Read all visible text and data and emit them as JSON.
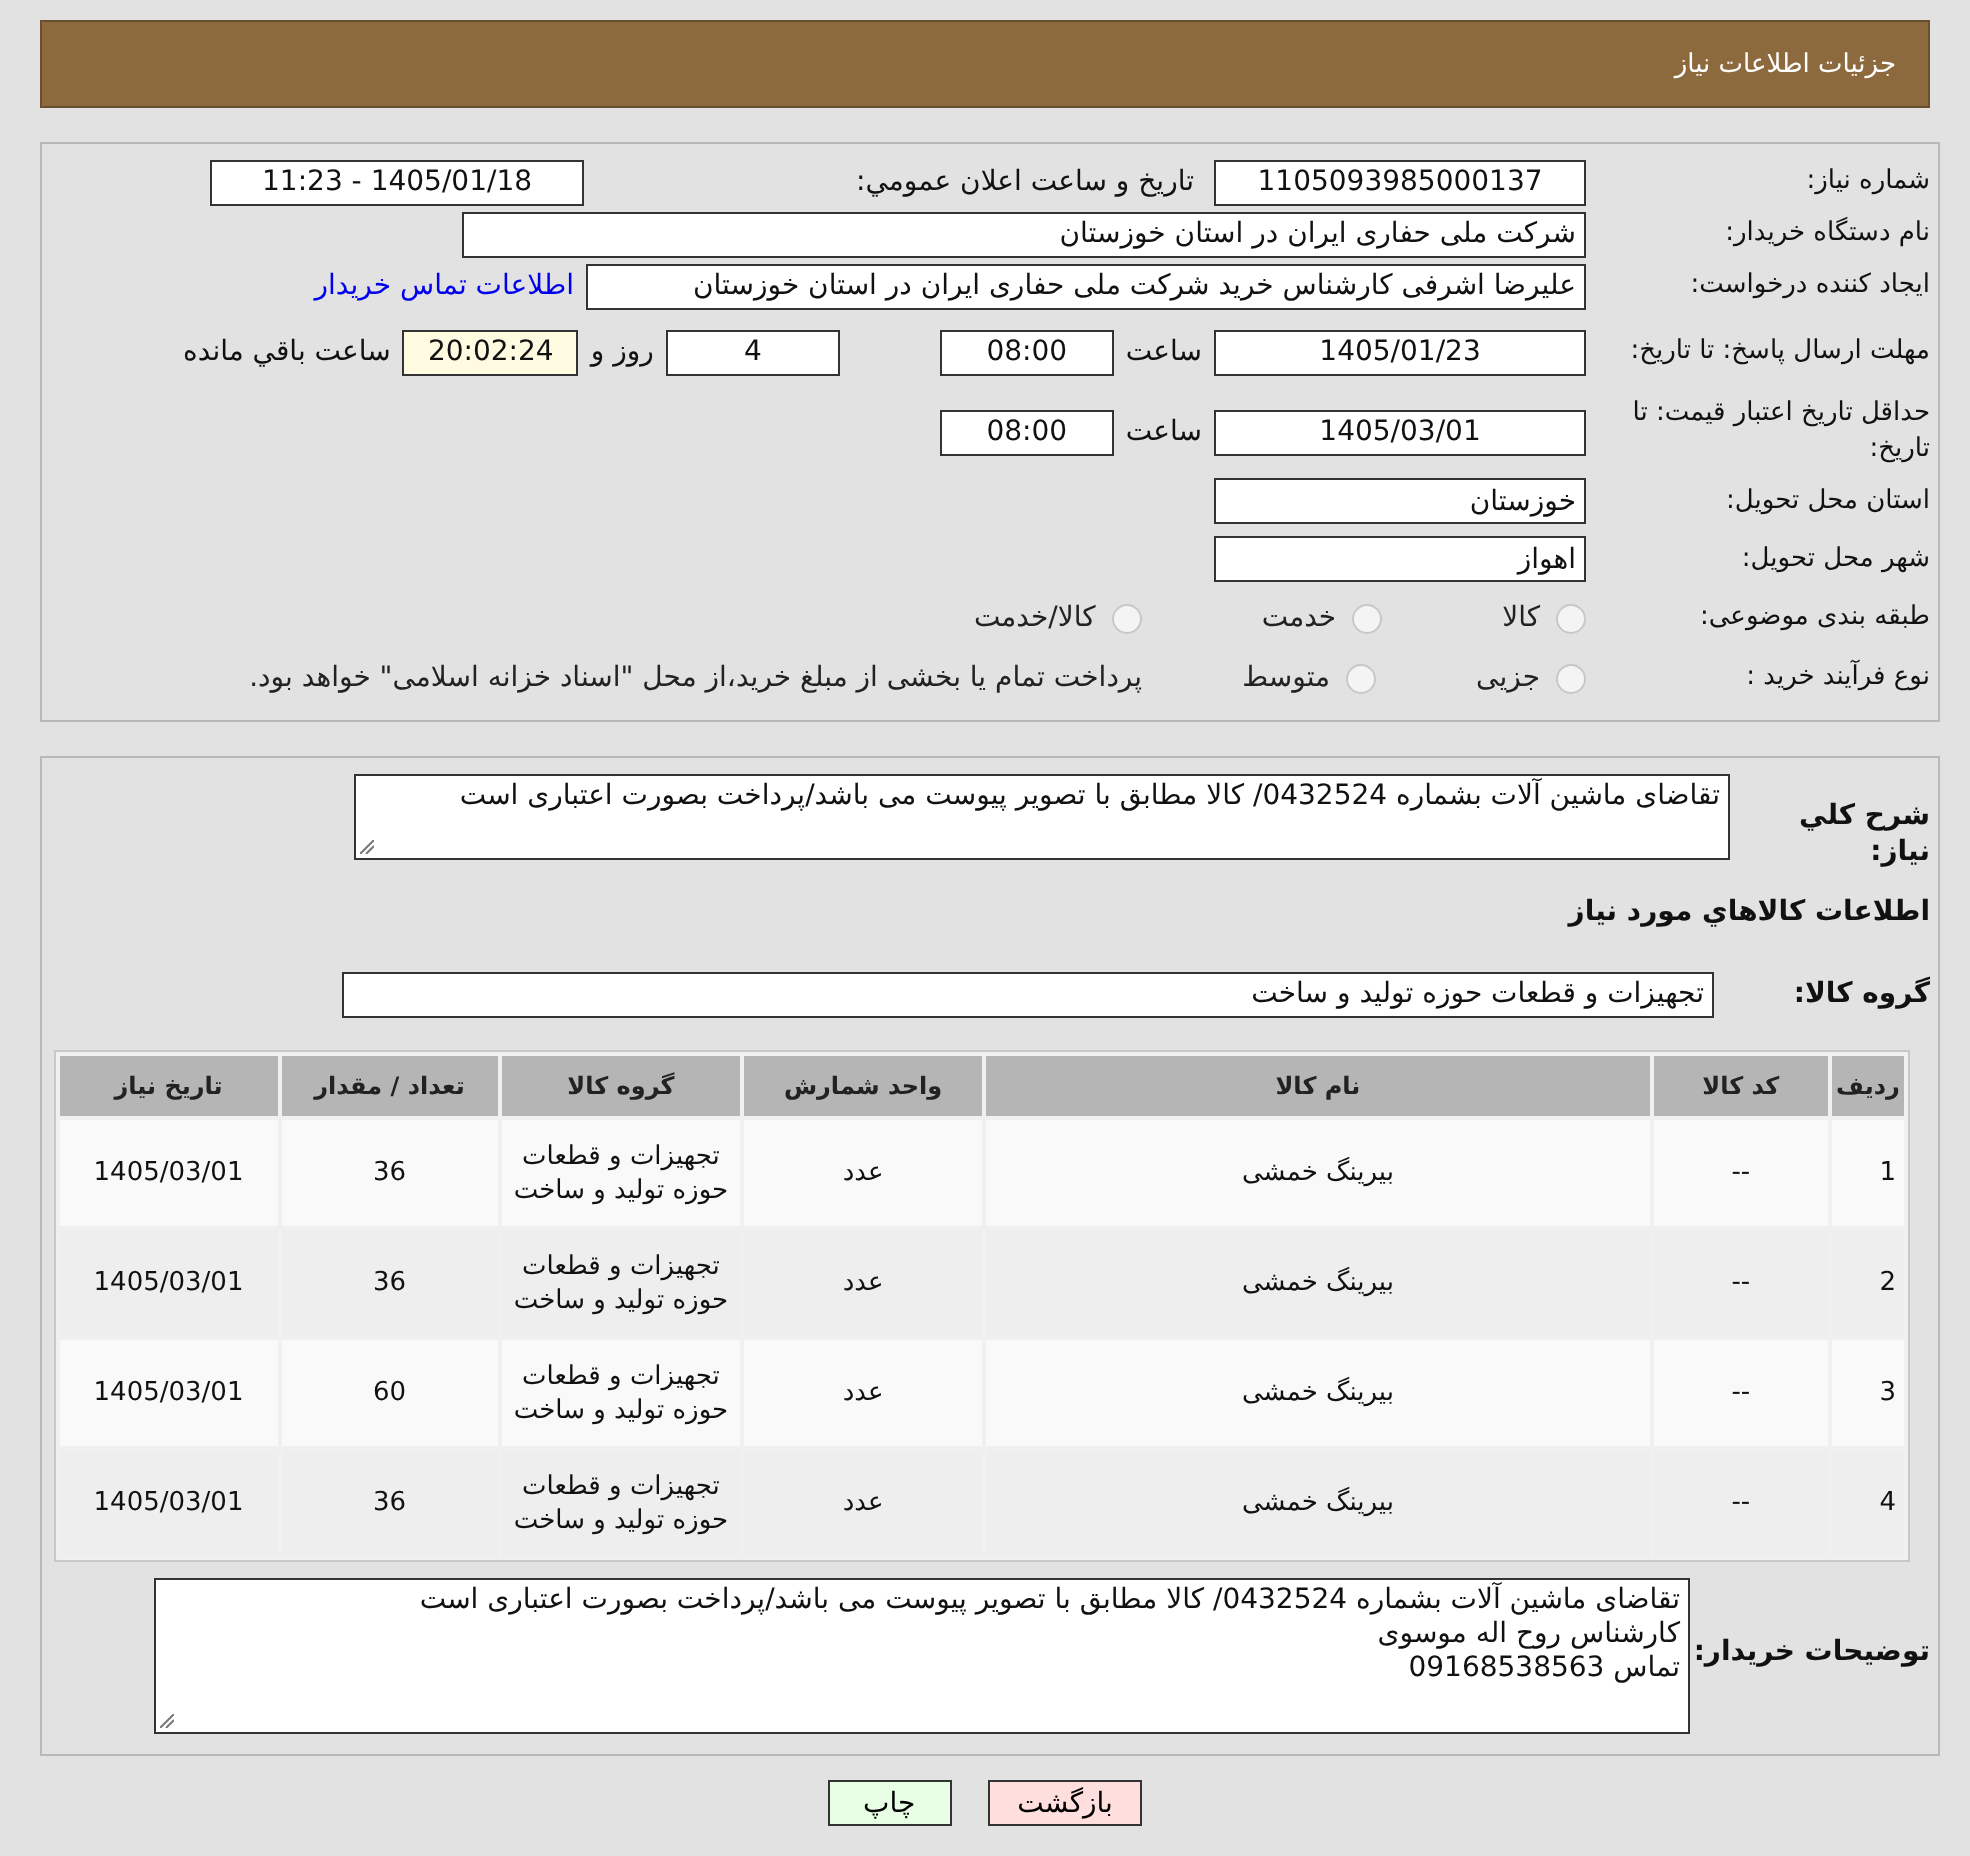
{
  "header": {
    "title": "جزئیات اطلاعات نیاز"
  },
  "details": {
    "need_number": {
      "label": "شماره نیاز:",
      "value": "1105093985000137"
    },
    "announce": {
      "label": "تاریخ و ساعت اعلان عمومي:",
      "value": "1405/01/18 - 11:23"
    },
    "buyer": {
      "label": "نام دستگاه خريدار:",
      "value": "شرکت ملی حفاری ایران در استان خوزستان"
    },
    "requester": {
      "label": "ایجاد کننده درخواست:",
      "value": "علیرضا اشرفی کارشناس خرید شرکت ملی حفاری ایران در استان خوزستان",
      "link": "اطلاعات تماس خریدار"
    },
    "deadline": {
      "label": "مهلت ارسال پاسخ: تا تاریخ:",
      "date": "1405/01/23",
      "time_label": "ساعت",
      "time": "08:00",
      "days": "4",
      "days_label": "روز و",
      "remaining": "20:02:24",
      "remaining_label": "ساعت باقي مانده"
    },
    "validity": {
      "label": "حداقل تاریخ اعتبار قیمت: تا تاریخ:",
      "date": "1405/03/01",
      "time_label": "ساعت",
      "time": "08:00"
    },
    "province": {
      "label": "استان محل تحویل:",
      "value": "خوزستان"
    },
    "city": {
      "label": "شهر محل تحویل:",
      "value": "اهواز"
    },
    "category": {
      "label": "طبقه بندی موضوعی:",
      "options": [
        {
          "label": "کالا",
          "selected": false
        },
        {
          "label": "خدمت",
          "selected": false
        },
        {
          "label": "کالا/خدمت",
          "selected": false
        }
      ]
    },
    "purchase_type": {
      "label": "نوع فرآیند خرید :",
      "options": [
        {
          "label": "جزیی",
          "selected": false
        },
        {
          "label": "متوسط",
          "selected": false
        }
      ],
      "note": "پرداخت تمام یا بخشی از مبلغ خرید،از محل \"اسناد خزانه اسلامی\" خواهد بود."
    }
  },
  "summary": {
    "label": "شرح کلي نياز:",
    "value": "تقاضای ماشین آلات بشماره 0432524/ کالا مطابق با تصویر پیوست می باشد/پرداخت بصورت اعتباری است"
  },
  "goods_heading": "اطلاعات کالاهاي مورد نياز",
  "goods_group": {
    "label": "گروه کالا:",
    "value": "تجهیزات و قطعات حوزه تولید و ساخت"
  },
  "table": {
    "columns": [
      "رديف",
      "کد کالا",
      "نام کالا",
      "واحد شمارش",
      "گروه کالا",
      "تعداد / مقدار",
      "تاريخ نياز"
    ],
    "rows": [
      [
        "1",
        "--",
        "بیرینگ خمشی",
        "عدد",
        "تجهیزات و قطعات حوزه تولید و ساخت",
        "36",
        "1405/03/01"
      ],
      [
        "2",
        "--",
        "بیرینگ خمشی",
        "عدد",
        "تجهیزات و قطعات حوزه تولید و ساخت",
        "36",
        "1405/03/01"
      ],
      [
        "3",
        "--",
        "بیرینگ خمشی",
        "عدد",
        "تجهیزات و قطعات حوزه تولید و ساخت",
        "60",
        "1405/03/01"
      ],
      [
        "4",
        "--",
        "بیرینگ خمشی",
        "عدد",
        "تجهیزات و قطعات حوزه تولید و ساخت",
        "36",
        "1405/03/01"
      ]
    ]
  },
  "buyer_notes": {
    "label": "توضیحات خریدار:",
    "lines": [
      "تقاضای ماشین آلات بشماره 0432524/ کالا مطابق با تصویر پیوست می باشد/پرداخت بصورت اعتباری است",
      "کارشناس روح اله موسوی",
      "تماس 09168538563"
    ]
  },
  "buttons": [
    {
      "label": "بازگشت",
      "kind": "back"
    },
    {
      "label": "چاپ",
      "kind": "print"
    }
  ]
}
